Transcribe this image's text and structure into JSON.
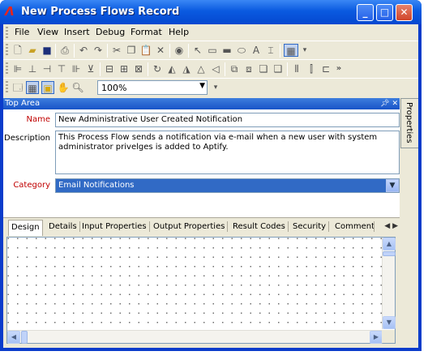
{
  "window": {
    "title": "New Process Flows Record",
    "min": "_",
    "max": "□",
    "close": "✕"
  },
  "menus": [
    "File",
    "View",
    "Insert",
    "Debug",
    "Format",
    "Help"
  ],
  "zoom": {
    "value": "100%"
  },
  "top_area": {
    "title": "Top Area"
  },
  "side_tab": {
    "label": "Properties"
  },
  "form": {
    "name_label": "Name",
    "name_value": "New Administrative User Created Notification",
    "description_label": "Description",
    "description_value": "This Process Flow sends a notification via e-mail when a new user with system\nadministrator privelges is added to Aptify.",
    "category_label": "Category",
    "category_value": "Email Notifications"
  },
  "tabs": [
    "Design",
    "Details",
    "Input Properties",
    "Output Properties",
    "Result Codes",
    "Security",
    "Comment"
  ],
  "colors": {
    "required_label": "#c00000",
    "selection": "#316ac5",
    "title_bar": "#0a5ae0"
  }
}
